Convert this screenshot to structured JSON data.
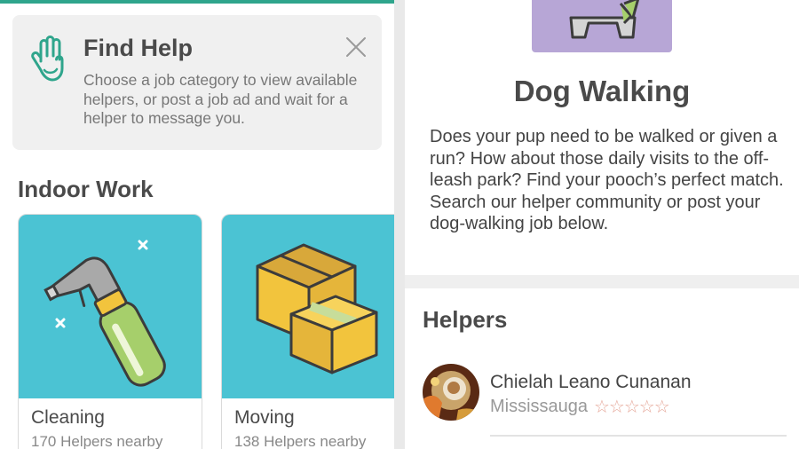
{
  "find_help": {
    "title": "Find Help",
    "description": "Choose a job category to view available helpers, or post a job ad and wait for a helper to message you."
  },
  "indoor_work": {
    "title": "Indoor Work",
    "categories": [
      {
        "name": "Cleaning",
        "count": "170 Helpers nearby",
        "icon": "spray-bottle-icon"
      },
      {
        "name": "Moving",
        "count": "138 Helpers nearby",
        "icon": "moving-boxes-icon"
      }
    ]
  },
  "detail": {
    "title": "Dog Walking",
    "description": "Does your pup need to be walked or given a run? How about those daily visits to the off-leash park? Find your pooch’s perfect match. Search our helper community or post your dog-walking job below."
  },
  "helpers": {
    "title": "Helpers",
    "items": [
      {
        "name": "Chielah Leano Cunanan",
        "location": "Mississauga",
        "stars": "☆☆☆☆☆",
        "rating": 0
      }
    ]
  },
  "colors": {
    "accent": "#2fa58c",
    "category_bg": "#4bc3d3",
    "hero_bg": "#b7a6d6",
    "star": "#e6a89a"
  }
}
